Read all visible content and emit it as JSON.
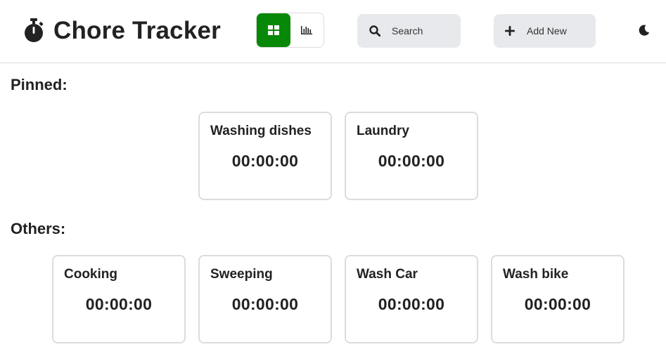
{
  "header": {
    "title": "Chore Tracker",
    "icon": "stopwatch-icon",
    "view_toggle": {
      "options": [
        {
          "icon": "grid-icon",
          "active": true
        },
        {
          "icon": "bar-chart-icon",
          "active": false
        }
      ],
      "active_color": "#078807"
    },
    "search": {
      "label": "Search",
      "icon": "search-icon"
    },
    "add_new": {
      "label": "Add New",
      "icon": "plus-icon"
    },
    "theme_toggle": {
      "icon": "moon-icon"
    }
  },
  "pinned": {
    "heading": "Pinned:",
    "chores": [
      {
        "name": "Washing dishes",
        "time": "00:00:00"
      },
      {
        "name": "Laundry",
        "time": "00:00:00"
      }
    ]
  },
  "others": {
    "heading": "Others:",
    "chores": [
      {
        "name": "Cooking",
        "time": "00:00:00"
      },
      {
        "name": "Sweeping",
        "time": "00:00:00"
      },
      {
        "name": "Wash Car",
        "time": "00:00:00"
      },
      {
        "name": "Wash bike",
        "time": "00:00:00"
      }
    ]
  },
  "colors": {
    "text": "#222222",
    "border": "#dcdcdc",
    "button_bg": "#e8e9ec",
    "accent": "#078807"
  }
}
